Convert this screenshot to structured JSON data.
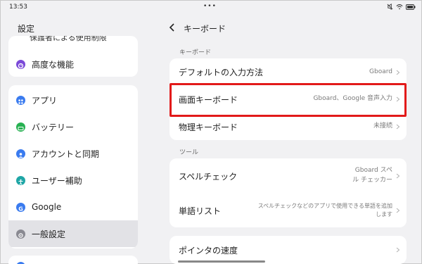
{
  "status": {
    "time": "13:53",
    "dots": "•••",
    "icons": [
      "mute-icon",
      "wifi-icon",
      "battery-icon"
    ]
  },
  "sidebar": {
    "title": "設定",
    "cut_item": "保護者による使用制限",
    "advanced": {
      "label": "高度な機能",
      "icon": "advanced-features-icon",
      "color": "#7b4ad8"
    },
    "items": [
      {
        "label": "アプリ",
        "icon": "apps-icon",
        "color": "#3a7bef"
      },
      {
        "label": "バッテリー",
        "icon": "battery-icon",
        "color": "#27b152"
      },
      {
        "label": "アカウントと同期",
        "icon": "account-icon",
        "color": "#3a7bef"
      },
      {
        "label": "ユーザー補助",
        "icon": "accessibility-icon",
        "color": "#1fa6a6"
      },
      {
        "label": "Google",
        "icon": "google-icon",
        "color": "#3a7bef"
      },
      {
        "label": "一般設定",
        "icon": "general-settings-icon",
        "color": "#8a8a92",
        "selected": true
      }
    ]
  },
  "main": {
    "title": "キーボード",
    "sections": [
      {
        "label": "キーボード",
        "rows": [
          {
            "label": "デフォルトの入力方法",
            "value": "Gboard"
          },
          {
            "label": "画面キーボード",
            "value": "Gboard、Google 音声入力",
            "highlighted": true
          },
          {
            "label": "物理キーボード",
            "value": "未接続"
          }
        ]
      },
      {
        "label": "ツール",
        "rows": [
          {
            "label": "スペルチェック",
            "value_lines": [
              "Gboard スペ",
              "ル チェッカー"
            ]
          },
          {
            "label": "単語リスト",
            "value_lines": [
              "スペルチェックなどのアプリで使用できる単語を追加",
              "します"
            ]
          }
        ]
      },
      {
        "label": "",
        "rows": [
          {
            "label": "ポインタの速度",
            "value": ""
          }
        ]
      }
    ]
  },
  "colors": {
    "background": "#f1f1f3",
    "card": "#ffffff",
    "highlight": "#e21a1a",
    "selected": "#e2e2e6"
  }
}
